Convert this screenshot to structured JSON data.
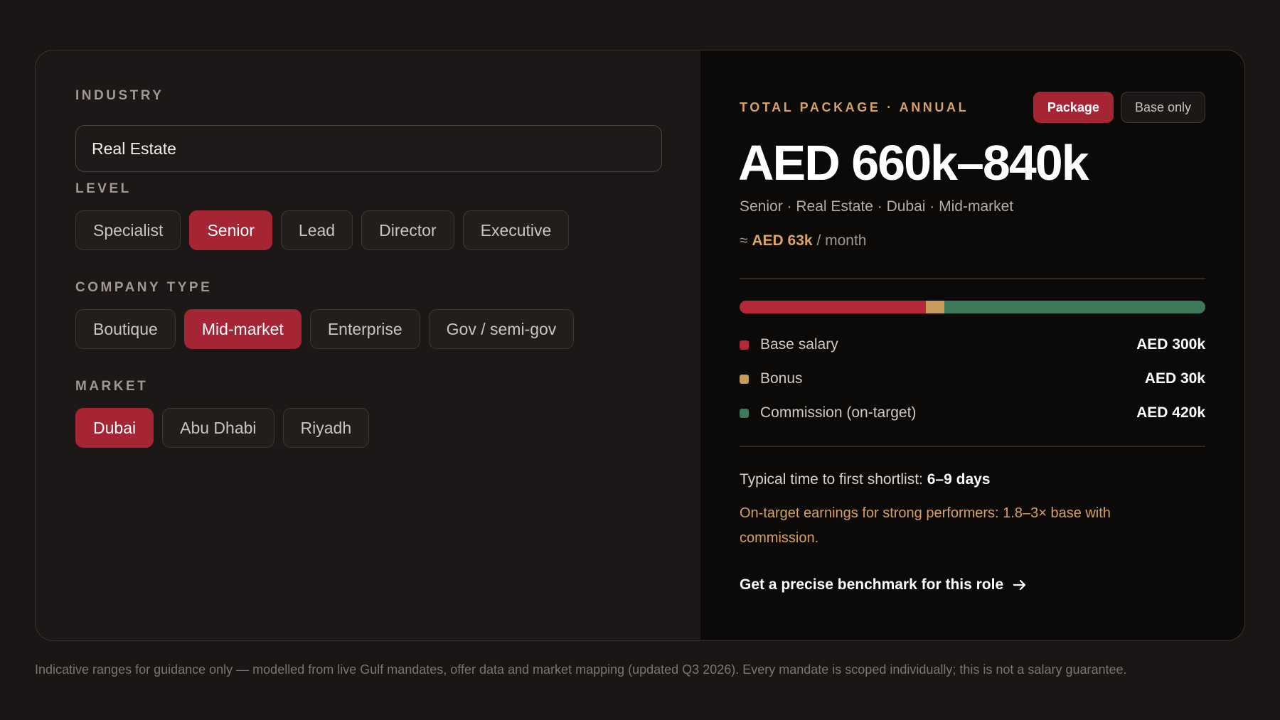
{
  "filters": {
    "industry": {
      "label": "INDUSTRY",
      "value": "Real Estate"
    },
    "level": {
      "label": "LEVEL",
      "options": [
        "Specialist",
        "Senior",
        "Lead",
        "Director",
        "Executive"
      ],
      "selected": "Senior"
    },
    "company_type": {
      "label": "COMPANY TYPE",
      "options": [
        "Boutique",
        "Mid-market",
        "Enterprise",
        "Gov / semi-gov"
      ],
      "selected": "Mid-market"
    },
    "market": {
      "label": "MARKET",
      "options": [
        "Dubai",
        "Abu Dhabi",
        "Riyadh"
      ],
      "selected": "Dubai"
    }
  },
  "result": {
    "heading": "TOTAL PACKAGE · ANNUAL",
    "toggle": {
      "package_label": "Package",
      "base_label": "Base only",
      "selected": "Package"
    },
    "range": "AED 660k–840k",
    "meta": "Senior · Real Estate · Dubai · Mid-market",
    "monthly_prefix": "≈",
    "monthly_amount": "AED 63k",
    "monthly_suffix": "/ month",
    "breakdown": [
      {
        "label": "Base salary",
        "value": "AED 300k",
        "amount_k": 300,
        "color": "#b5283a"
      },
      {
        "label": "Bonus",
        "value": "AED 30k",
        "amount_k": 30,
        "color": "#c99c5b"
      },
      {
        "label": "Commission (on-target)",
        "value": "AED 420k",
        "amount_k": 420,
        "color": "#3d7a5c"
      }
    ],
    "shortlist_text": "Typical time to first shortlist:",
    "shortlist_value": "6–9 days",
    "note": "On-target earnings for strong performers: 1.8–3× base with commission.",
    "cta_label": "Get a precise benchmark for this role",
    "cta_icon": "arrow-right-icon"
  },
  "footer": "Indicative ranges for guidance only — modelled from live Gulf mandates, offer data and market mapping (updated Q3 2026). Every mandate is scoped individually; this is not a salary guarantee."
}
